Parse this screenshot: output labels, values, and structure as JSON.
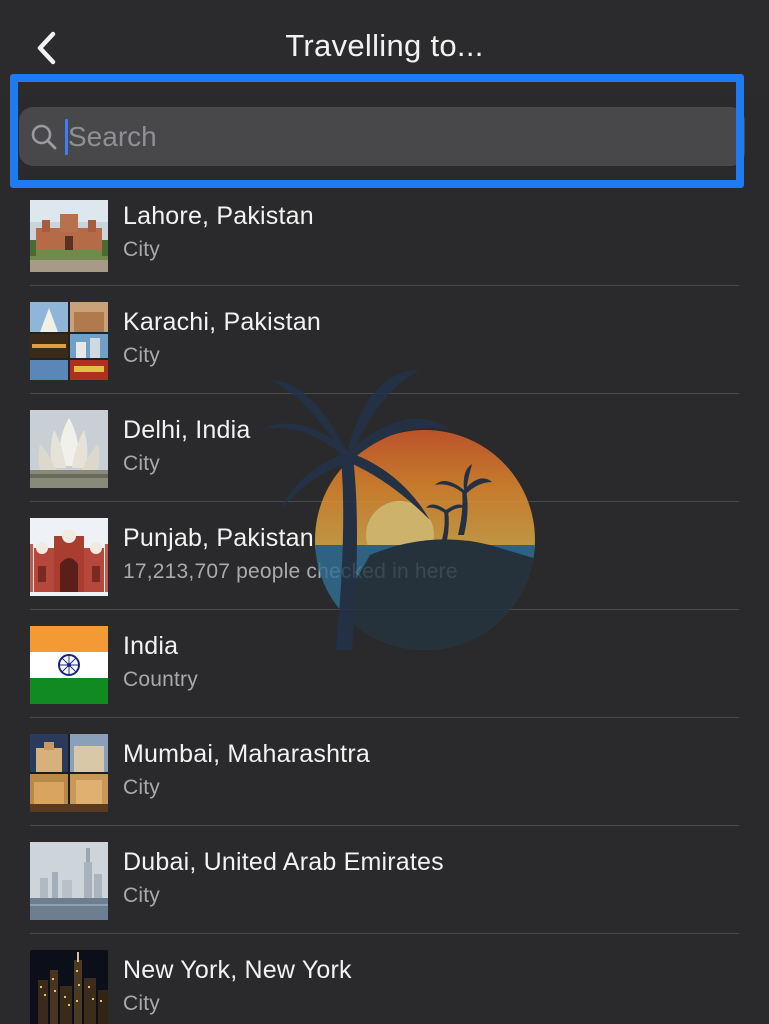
{
  "header": {
    "title": "Travelling to...",
    "back_icon": "chevron-left-icon"
  },
  "search": {
    "placeholder": "Search",
    "value": "",
    "icon": "search-icon",
    "highlight_color": "#1f7bf2"
  },
  "places": [
    {
      "name": "Lahore, Pakistan",
      "subtitle": "City",
      "thumb": "lahore-fort"
    },
    {
      "name": "Karachi, Pakistan",
      "subtitle": "City",
      "thumb": "karachi-collage"
    },
    {
      "name": "Delhi, India",
      "subtitle": "City",
      "thumb": "lotus-temple"
    },
    {
      "name": "Punjab, Pakistan",
      "subtitle": "17,213,707 people checked in here",
      "thumb": "badshahi-mosque"
    },
    {
      "name": "India",
      "subtitle": "Country",
      "thumb": "india-flag"
    },
    {
      "name": "Mumbai, Maharashtra",
      "subtitle": "City",
      "thumb": "mumbai-collage"
    },
    {
      "name": "Dubai, United Arab Emirates",
      "subtitle": "City",
      "thumb": "dubai-skyline"
    },
    {
      "name": "New York, New York",
      "subtitle": "City",
      "thumb": "new-york-night"
    }
  ],
  "colors": {
    "background": "#2a2a2c",
    "search_field": "#48484b",
    "text_primary": "#f2f2f2",
    "text_secondary": "#a9a9ae",
    "caret": "#3f7cf5"
  }
}
